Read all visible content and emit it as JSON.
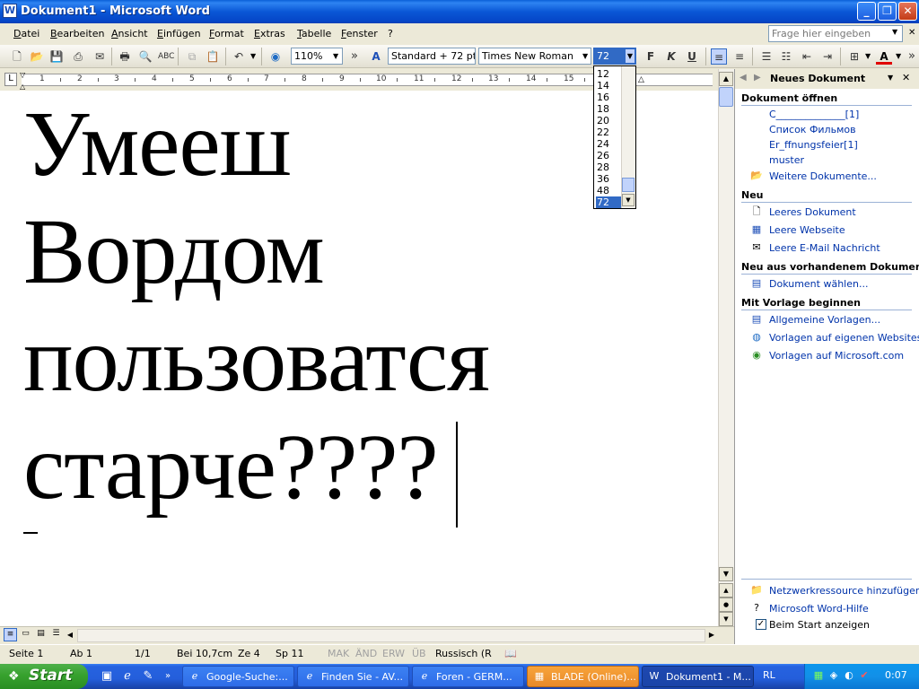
{
  "window": {
    "title": "Dokument1 - Microsoft Word",
    "app_icon": "word-icon"
  },
  "menu": [
    "Datei",
    "Bearbeiten",
    "Ansicht",
    "Einfügen",
    "Format",
    "Extras",
    "Tabelle",
    "Fenster",
    "?"
  ],
  "ask_placeholder": "Frage hier eingeben",
  "toolbar": {
    "zoom": "110%",
    "style": "Standard + 72 pt",
    "font": "Times New Roman",
    "size": "72",
    "bold": "F",
    "italic": "K",
    "underline": "U",
    "chevron": "»"
  },
  "font_size_options": [
    "12",
    "14",
    "16",
    "18",
    "20",
    "22",
    "24",
    "26",
    "28",
    "36",
    "48",
    "72"
  ],
  "selected_font_size": "72",
  "ruler_numbers": [
    "1",
    "2",
    "3",
    "4",
    "5",
    "6",
    "7",
    "8",
    "9",
    "10",
    "11",
    "12",
    "13",
    "14",
    "15",
    "17"
  ],
  "document_lines": [
    "Умееш",
    "Вордом",
    "пользоватся",
    "старче????"
  ],
  "task_pane": {
    "title": "Neues Dokument",
    "sections": [
      {
        "heading": "Dokument öffnen",
        "items": [
          "C______________[1]",
          "Список Фильмов",
          "Er_ffnungsfeier[1]",
          "muster",
          "Weitere Dokumente..."
        ]
      },
      {
        "heading": "Neu",
        "items": [
          "Leeres Dokument",
          "Leere Webseite",
          "Leere E-Mail Nachricht"
        ]
      },
      {
        "heading": "Neu aus vorhandenem Dokument",
        "items": [
          "Dokument wählen..."
        ]
      },
      {
        "heading": "Mit Vorlage beginnen",
        "items": [
          "Allgemeine Vorlagen...",
          "Vorlagen auf eigenen Websites...",
          "Vorlagen auf Microsoft.com"
        ]
      }
    ],
    "footer": [
      "Netzwerkressource hinzufügen...",
      "Microsoft Word-Hilfe",
      "Beim Start anzeigen"
    ]
  },
  "status": {
    "page": "Seite 1",
    "section": "Ab 1",
    "pages": "1/1",
    "at": "Bei 10,7cm",
    "line": "Ze 4",
    "col": "Sp 11",
    "mak": "MAK",
    "and": "ÄND",
    "erw": "ERW",
    "ub": "ÜB",
    "lang": "Russisch (R"
  },
  "taskbar": {
    "start": "Start",
    "buttons": [
      "Google-Suche:...",
      "Finden Sie - AV...",
      "Foren - GERM...",
      "BLADE (Online)...",
      "Dokument1 - M..."
    ],
    "language": "RL",
    "clock": "0:07"
  }
}
